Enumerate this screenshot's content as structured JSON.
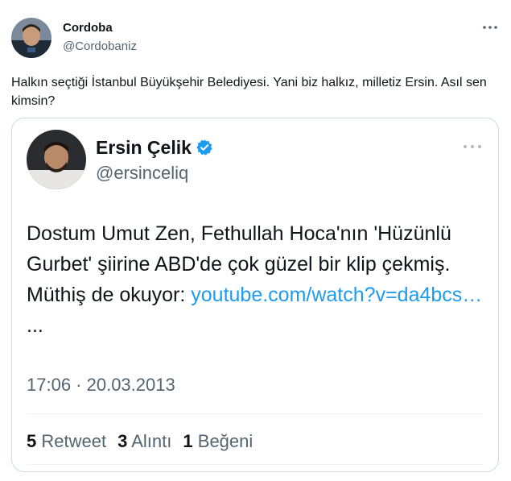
{
  "outer_tweet": {
    "name": "Cordoba",
    "handle": "@Cordobaniz",
    "text": "Halkın seçtiği İstanbul Büyükşehir Belediyesi. Yani biz halkız, milletiz Ersin. Asıl sen kimsin?",
    "more_icon": "more-horizontal-icon"
  },
  "quoted_tweet": {
    "name": "Ersin Çelik",
    "verified_icon": "verified-badge-icon",
    "handle": "@ersinceliq",
    "text_main": "Dostum Umut Zen, Fethullah Hoca'nın 'Hüzünlü Gurbet' şiirine ABD'de çok güzel bir klip çekmiş. Müthiş de okuyor: ",
    "link_text": "youtube.com/watch?v=da4bcs…",
    "ellipsis": " ...",
    "timestamp": "17:06 · 20.03.2013",
    "retweets_count": "5",
    "retweets_label": "Retweet",
    "quotes_count": "3",
    "quotes_label": "Alıntı",
    "likes_count": "1",
    "likes_label": "Beğeni"
  },
  "colors": {
    "accent": "#1d9bf0",
    "text": "#0f1419",
    "muted": "#536471",
    "border": "#cfd9de"
  }
}
